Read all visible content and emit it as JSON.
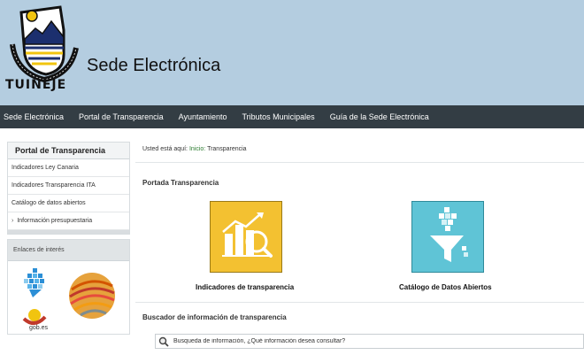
{
  "header": {
    "logo_text": "TUINEJE",
    "logo_arc_text": "Ayuntamiento de",
    "site_title": "Sede Electrónica"
  },
  "nav": {
    "items": [
      {
        "label": "Sede Electrónica"
      },
      {
        "label": "Portal de Transparencia"
      },
      {
        "label": "Ayuntamiento"
      },
      {
        "label": "Tributos Municipales"
      },
      {
        "label": "Guía de la Sede Electrónica"
      }
    ]
  },
  "sidebar": {
    "title": "Portal de Transparencia",
    "items": [
      {
        "label": "Indicadores Ley Canaria"
      },
      {
        "label": "Indicadores Transparencia ITA"
      },
      {
        "label": "Catálogo de datos abiertos"
      },
      {
        "label": "Información presupuestaria",
        "icon": "chevron-right-icon"
      }
    ],
    "links_title": "Enlaces de interés",
    "gob_logo_text": "gob.es"
  },
  "breadcrumb": {
    "prefix": "Usted está aquí:",
    "home": "Inicio:",
    "current": "Transparencia"
  },
  "main": {
    "section_title": "Portada Transparencia",
    "tiles": [
      {
        "label": "Indicadores de transparencia",
        "icon": "chart-magnifier-icon",
        "color": "#f3c131"
      },
      {
        "label": "Catálogo de Datos Abiertos",
        "icon": "data-funnel-icon",
        "color": "#5fc4d6"
      }
    ],
    "search_title": "Buscador de información de transparencia",
    "search_placeholder": "Busqueda de información, ¿Qué información desea consultar?"
  },
  "colors": {
    "header_bg": "#b4cde0",
    "nav_bg": "#333d44",
    "breadcrumb_link": "#2e7d32"
  }
}
